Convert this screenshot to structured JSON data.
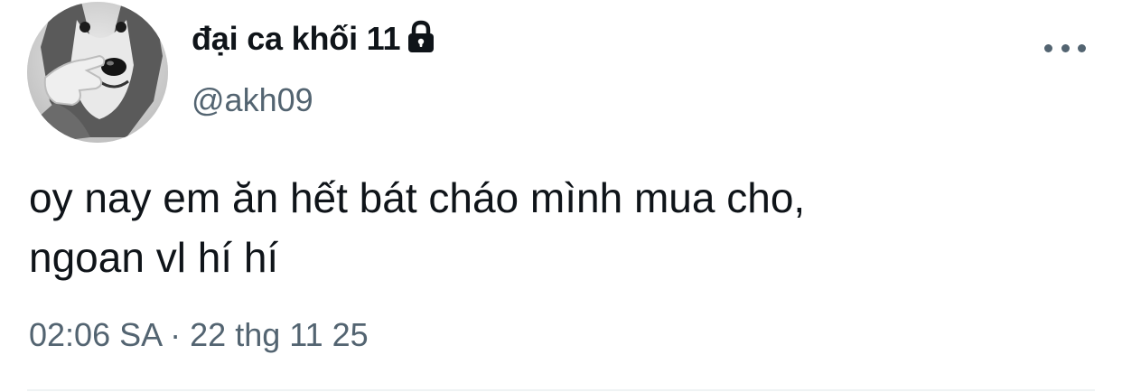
{
  "author": {
    "display_name": "đại ca khối 11",
    "handle": "@akh09",
    "avatar_icon": "husky-dog-pointing-avatar",
    "protected_icon": "lock-icon"
  },
  "menu": {
    "icon": "more-horizontal-icon"
  },
  "tweet": {
    "text": "oy nay em ăn hết bát cháo mình mua cho,\nngoan vl hí hí",
    "time": "02:06 SA",
    "separator": "·",
    "date": "22 thg 11 25"
  },
  "colors": {
    "text_primary": "#0f1419",
    "text_secondary": "#536471",
    "divider": "#eff3f4",
    "background": "#ffffff"
  }
}
